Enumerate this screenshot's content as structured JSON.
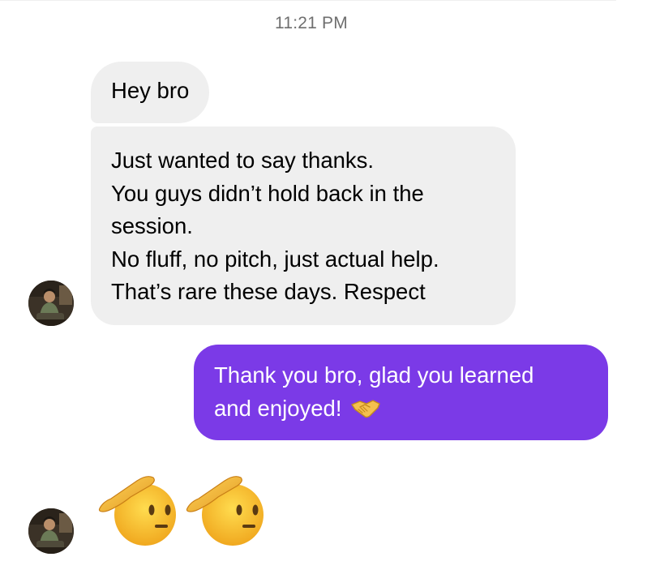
{
  "thread": {
    "timestamp": "11:21 PM",
    "messages": [
      {
        "sender": "other",
        "lines": [
          "Hey bro"
        ]
      },
      {
        "sender": "other",
        "lines": [
          "Just wanted to say thanks.",
          "You guys didn’t hold back in the",
          "session.",
          "No fluff, no pitch, just actual help.",
          "That’s rare these days. Respect"
        ]
      },
      {
        "sender": "me",
        "lines": [
          "Thank you bro, glad you learned",
          "and enjoyed!"
        ],
        "trailing_icon": "handshake-emoji"
      },
      {
        "sender": "other",
        "emojis": [
          "saluting-face-emoji",
          "saluting-face-emoji"
        ]
      }
    ]
  },
  "colors": {
    "incoming_bubble": "#efefef",
    "outgoing_bubble": "#7b3ae7",
    "timestamp_text": "#6f6f6f"
  }
}
